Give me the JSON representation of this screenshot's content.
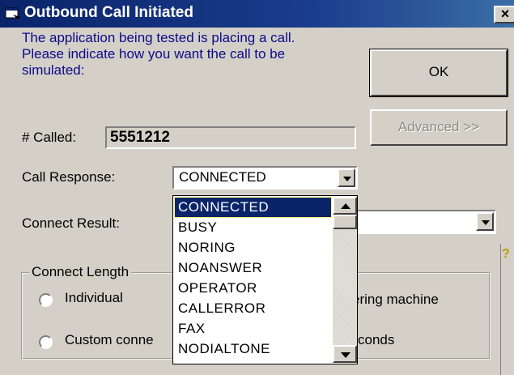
{
  "window": {
    "title": "Outbound Call Initiated",
    "close_label": "×"
  },
  "prompt": "The application being tested is placing a call.  Please indicate how you want the call to be simulated:",
  "buttons": {
    "ok_label": "OK",
    "advanced_label": "Advanced >>"
  },
  "called": {
    "label": "# Called:",
    "value": "5551212"
  },
  "call_response": {
    "label": "Call Response:",
    "selected": "CONNECTED",
    "options": [
      "CONNECTED",
      "BUSY",
      "NORING",
      "NOANSWER",
      "OPERATOR",
      "CALLERROR",
      "FAX",
      "NODIALTONE"
    ]
  },
  "connect_result": {
    "label": "Connect Result:",
    "value": ""
  },
  "connect_length": {
    "legend": "Connect Length",
    "radio_individual": "Individual",
    "radio_custom": "Custom conne",
    "text_answering": "ering machine",
    "text_seconds": "conds"
  },
  "icons": {
    "window_icon": "phone-window-icon",
    "side_icon": "help-icon"
  }
}
